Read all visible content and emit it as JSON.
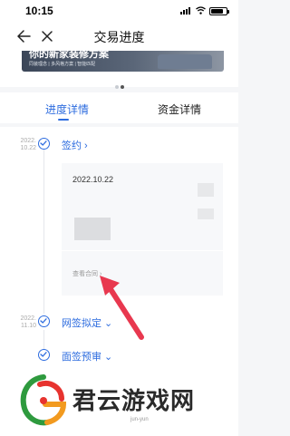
{
  "status_bar": {
    "time": "10:15"
  },
  "nav": {
    "title": "交易进度"
  },
  "banner": {
    "headline": "你的新家装修方案",
    "subline": "同装理念 | 多风格方案 | 智能匹配"
  },
  "tabs": [
    {
      "label": "进度详情",
      "active": true
    },
    {
      "label": "资金详情",
      "active": false
    }
  ],
  "timeline": [
    {
      "date_year": "2022.",
      "date_day": "10.22",
      "title": "签约 ›"
    },
    {
      "date_year": "2022.",
      "date_day": "11.10",
      "title": "网签拟定 ⌄"
    },
    {
      "date_year": "",
      "date_day": "",
      "title": "面签预审 ⌄"
    }
  ],
  "contract_card": {
    "date": "2022.10.22",
    "link_label": "查看合同 ›"
  },
  "watermark": {
    "text": "君云游戏网",
    "sub": "jun-yun"
  },
  "colors": {
    "accent": "#2d6cdf",
    "arrow": "#e8384f"
  }
}
